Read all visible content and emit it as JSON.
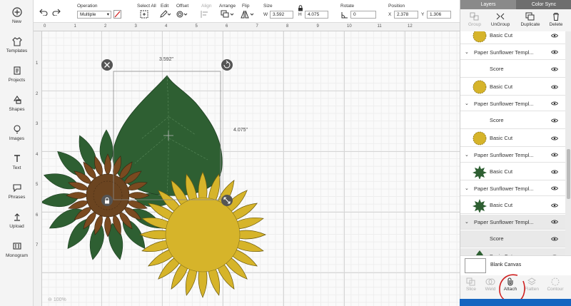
{
  "leftbar": {
    "items": [
      {
        "label": "New",
        "icon": "plus-circle-icon"
      },
      {
        "label": "Templates",
        "icon": "shirt-icon"
      },
      {
        "label": "Projects",
        "icon": "projects-icon"
      },
      {
        "label": "Shapes",
        "icon": "shapes-icon"
      },
      {
        "label": "Images",
        "icon": "lightbulb-icon"
      },
      {
        "label": "Text",
        "icon": "text-icon"
      },
      {
        "label": "Phrases",
        "icon": "speech-bubble-icon"
      },
      {
        "label": "Upload",
        "icon": "upload-icon"
      },
      {
        "label": "Monogram",
        "icon": "monogram-icon"
      }
    ]
  },
  "toolbar": {
    "operation_label": "Operation",
    "operation_value": "Multiple",
    "select_all_label": "Select All",
    "edit_label": "Edit",
    "offset_label": "Offset",
    "align_label": "Align",
    "arrange_label": "Arrange",
    "flip_label": "Flip",
    "size_label": "Size",
    "w_label": "W",
    "w_value": "3.592",
    "h_label": "H",
    "h_value": "4.075",
    "rotate_label": "Rotate",
    "rotate_value": "0",
    "position_label": "Position",
    "x_label": "X",
    "x_value": "2.378",
    "y_label": "Y",
    "y_value": "1.306"
  },
  "ruler": {
    "h": [
      "0",
      "1",
      "2",
      "3",
      "4",
      "5",
      "6",
      "7",
      "8",
      "9",
      "10",
      "11",
      "12"
    ],
    "v": [
      "1",
      "2",
      "3",
      "4",
      "5",
      "6",
      "7"
    ]
  },
  "canvas": {
    "width_label": "3.592\"",
    "height_label": "4.075\"",
    "zoom": "100%"
  },
  "panel": {
    "tabs": [
      "Layers",
      "Color Sync"
    ],
    "tools": [
      {
        "label": "Group",
        "enabled": false
      },
      {
        "label": "UnGroup",
        "enabled": true
      },
      {
        "label": "Duplicate",
        "enabled": true
      },
      {
        "label": "Delete",
        "enabled": true
      }
    ],
    "layers": [
      {
        "type": "child",
        "label": "Basic Cut",
        "thumb": "sunflower-yellow"
      },
      {
        "type": "group",
        "label": "Paper Sunflower Templ..."
      },
      {
        "type": "child",
        "label": "Score",
        "thumb": "blank"
      },
      {
        "type": "child",
        "label": "Basic Cut",
        "thumb": "sunflower-yellow"
      },
      {
        "type": "group",
        "label": "Paper Sunflower Templ..."
      },
      {
        "type": "child",
        "label": "Score",
        "thumb": "blank"
      },
      {
        "type": "child",
        "label": "Basic Cut",
        "thumb": "sunflower-yellow"
      },
      {
        "type": "group",
        "label": "Paper Sunflower Templ..."
      },
      {
        "type": "child",
        "label": "Basic Cut",
        "thumb": "star-green"
      },
      {
        "type": "group",
        "label": "Paper Sunflower Templ..."
      },
      {
        "type": "child",
        "label": "Basic Cut",
        "thumb": "star-green"
      },
      {
        "type": "group",
        "label": "Paper Sunflower Templ...",
        "selected": true
      },
      {
        "type": "child",
        "label": "Score",
        "thumb": "blank",
        "selected": true
      },
      {
        "type": "child",
        "label": "Basic Cut",
        "thumb": "leaf-green",
        "selected": true
      }
    ],
    "blank_canvas": "Blank Canvas",
    "bottom_tools": [
      {
        "label": "Slice",
        "enabled": false
      },
      {
        "label": "Weld",
        "enabled": false
      },
      {
        "label": "Attach",
        "enabled": true
      },
      {
        "label": "Flatten",
        "enabled": false
      },
      {
        "label": "Contour",
        "enabled": false
      }
    ]
  },
  "colors": {
    "leaf": "#2e5f32",
    "petal": "#d6b42a",
    "center": "#6b4420",
    "accent": "#1565c0",
    "annotation": "#d01f1f"
  }
}
